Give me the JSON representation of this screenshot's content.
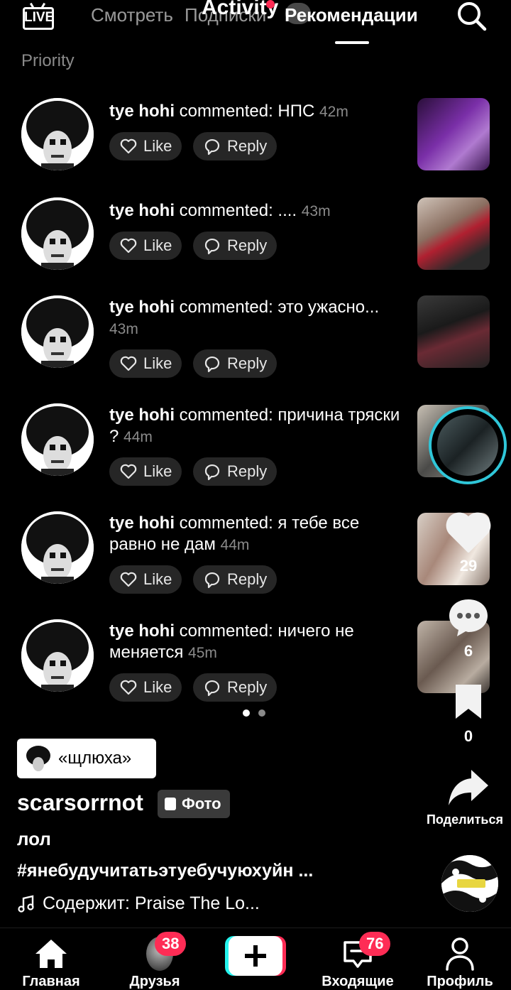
{
  "top_bar": {
    "live_label": "LIVE",
    "tab_watch": "Смотреть",
    "tab_subscriptions": "Подписки",
    "tab_activity": "Activity",
    "tab_recommendations": "Рекомендации"
  },
  "section_title": "Priority",
  "notifications": [
    {
      "user": "tye hohi",
      "text": " commented: НПС ",
      "time": "42m",
      "like": "Like",
      "reply": "Reply"
    },
    {
      "user": "tye hohi",
      "text": " commented: .... ",
      "time": "43m",
      "like": "Like",
      "reply": "Reply"
    },
    {
      "user": "tye hohi",
      "text": " commented: это ужасно... ",
      "time": "43m",
      "like": "Like",
      "reply": "Reply"
    },
    {
      "user": "tye hohi",
      "text": " commented: причина тряски ? ",
      "time": "44m",
      "like": "Like",
      "reply": "Reply"
    },
    {
      "user": "tye hohi",
      "text": " commented: я тебе все равно не дам ",
      "time": "44m",
      "like": "Like",
      "reply": "Reply"
    },
    {
      "user": "tye hohi",
      "text": " commented: ничего не меняется ",
      "time": "45m",
      "like": "Like",
      "reply": "Reply"
    }
  ],
  "pager": {
    "total": 2,
    "active": 1
  },
  "actions": {
    "likes": "29",
    "comments": "6",
    "saves": "0",
    "share_label": "Поделиться"
  },
  "post": {
    "sound_tag": "«щлюха»",
    "author": "scarsorrnot",
    "photo_badge": "Фото",
    "caption": "лол",
    "hashtags": "#янебудучитатьэтуебучуюхуйн ...",
    "music": "Содержит: Praise The Lo..."
  },
  "bottom_nav": {
    "home": "Главная",
    "friends": "Друзья",
    "friends_badge": "38",
    "inbox": "Входящие",
    "inbox_badge": "76",
    "profile": "Профиль"
  },
  "colors": {
    "accent_red": "#fe2c55",
    "accent_cyan": "#25f4ee",
    "background": "#000000"
  },
  "icons": [
    "live-icon",
    "search-icon",
    "heart-icon",
    "comment-bubble-icon",
    "bookmark-icon",
    "share-arrow-icon",
    "home-icon",
    "plus-icon",
    "inbox-icon",
    "profile-icon",
    "music-note-icon"
  ]
}
